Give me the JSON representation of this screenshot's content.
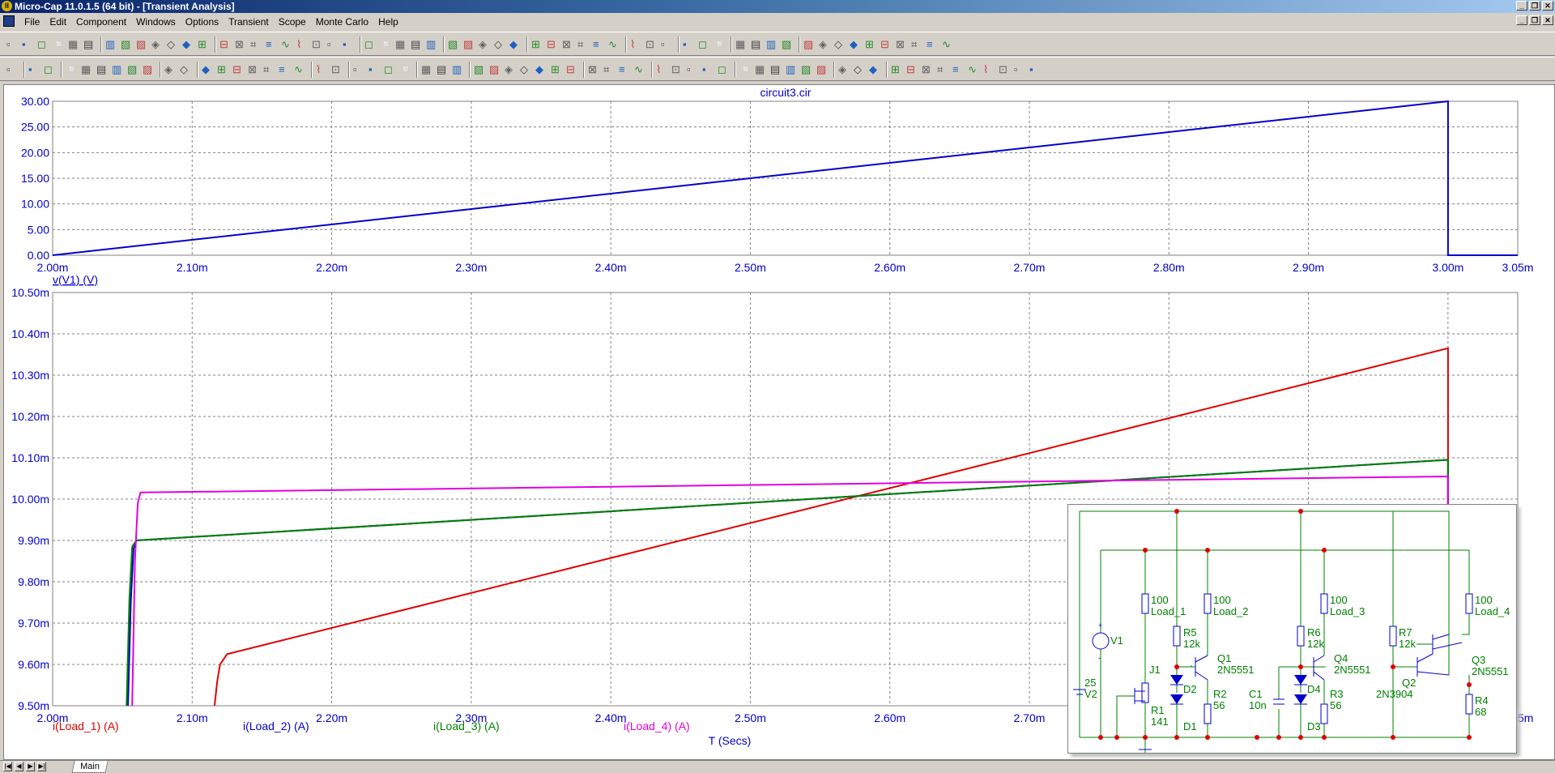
{
  "window": {
    "title": "Micro-Cap 11.0.1.5 (64 bit) - [Transient Analysis]",
    "app_icon_letter": "II"
  },
  "menu": {
    "items": [
      "File",
      "Edit",
      "Component",
      "Windows",
      "Options",
      "Transient",
      "Scope",
      "Monte Carlo",
      "Help"
    ]
  },
  "plot": {
    "title": "circuit3.cir",
    "x_axis_label": "T (Secs)",
    "colors": {
      "axis_text": "#0000cc",
      "grid": "#808080",
      "red": "#e00000",
      "blue": "#0000cc",
      "green": "#008000",
      "magenta": "#e000e0"
    }
  },
  "chart_data": [
    {
      "type": "line",
      "title": "circuit3.cir",
      "xlabel": "",
      "ylabel": "",
      "xlim": [
        2.0,
        3.05
      ],
      "ylim": [
        0,
        30
      ],
      "x_ticks": [
        "2.00m",
        "2.10m",
        "2.20m",
        "2.30m",
        "2.40m",
        "2.50m",
        "2.60m",
        "2.70m",
        "2.80m",
        "2.90m",
        "3.00m",
        "3.05m"
      ],
      "y_ticks": [
        "30.00",
        "25.00",
        "20.00",
        "15.00",
        "10.00",
        "5.00",
        "0.00"
      ],
      "grid": true,
      "series": [
        {
          "name": "v(V1) (V)",
          "color": "#0000cc",
          "x": [
            2.0,
            3.0,
            3.0,
            3.05
          ],
          "y": [
            0,
            30,
            0,
            0
          ]
        }
      ]
    },
    {
      "type": "line",
      "xlabel": "T (Secs)",
      "ylabel": "",
      "xlim": [
        2.0,
        3.05
      ],
      "ylim": [
        9.5,
        10.5
      ],
      "x_ticks": [
        "2.00m",
        "2.10m",
        "2.20m",
        "2.30m",
        "2.40m",
        "2.50m",
        "2.60m",
        "2.70m",
        "2.80m",
        "2.90m",
        "3.00m",
        "3.05m"
      ],
      "y_ticks": [
        "10.50m",
        "10.40m",
        "10.30m",
        "10.20m",
        "10.10m",
        "10.00m",
        "9.90m",
        "9.80m",
        "9.70m",
        "9.60m",
        "9.50m"
      ],
      "grid": true,
      "series": [
        {
          "name": "i(Load_1) (A)",
          "color": "#e00000",
          "x": [
            2.116,
            2.118,
            2.12,
            2.125,
            3.0,
            3.0
          ],
          "y": [
            9.5,
            9.56,
            9.6,
            9.625,
            10.365,
            9.5
          ]
        },
        {
          "name": "i(Load_2) (A)",
          "color": "#0000cc",
          "x": [
            2.054,
            2.056,
            2.058,
            2.06,
            3.0,
            3.0
          ],
          "y": [
            9.5,
            9.75,
            9.88,
            9.9,
            10.095,
            9.5
          ]
        },
        {
          "name": "i(Load_3) (A)",
          "color": "#008000",
          "x": [
            2.053,
            2.055,
            2.057,
            2.06,
            3.0,
            3.0
          ],
          "y": [
            9.5,
            9.76,
            9.885,
            9.9,
            10.095,
            9.5
          ]
        },
        {
          "name": "i(Load_4) (A)",
          "color": "#e000e0",
          "x": [
            2.057,
            2.059,
            2.061,
            2.063,
            3.0,
            3.0
          ],
          "y": [
            9.5,
            9.85,
            9.99,
            10.016,
            10.055,
            9.5
          ]
        }
      ]
    }
  ],
  "schematic": {
    "labels": {
      "v1": "V1",
      "v2": [
        "25",
        "V2"
      ],
      "j1": "J1",
      "r1": [
        "R1",
        "141"
      ],
      "load1": [
        "100",
        "Load_1"
      ],
      "r5": [
        "R5",
        "12k"
      ],
      "d2": "D2",
      "d1": "D1",
      "load2": [
        "100",
        "Load_2"
      ],
      "q1": [
        "Q1",
        "2N5551"
      ],
      "r2": [
        "R2",
        "56"
      ],
      "c1": [
        "C1",
        "10n"
      ],
      "r6": [
        "R6",
        "12k"
      ],
      "d4": "D4",
      "d3": "D3",
      "load3": [
        "100",
        "Load_3"
      ],
      "q4": [
        "Q4",
        "2N5551"
      ],
      "r3": [
        "R3",
        "56"
      ],
      "r7": [
        "R7",
        "12k"
      ],
      "q2": [
        "Q2",
        "2N3904"
      ],
      "load4": [
        "100",
        "Load_4"
      ],
      "q3": [
        "Q3",
        "2N5551"
      ],
      "r4": [
        "R4",
        "68"
      ]
    }
  },
  "tabs": {
    "main": "Main"
  }
}
